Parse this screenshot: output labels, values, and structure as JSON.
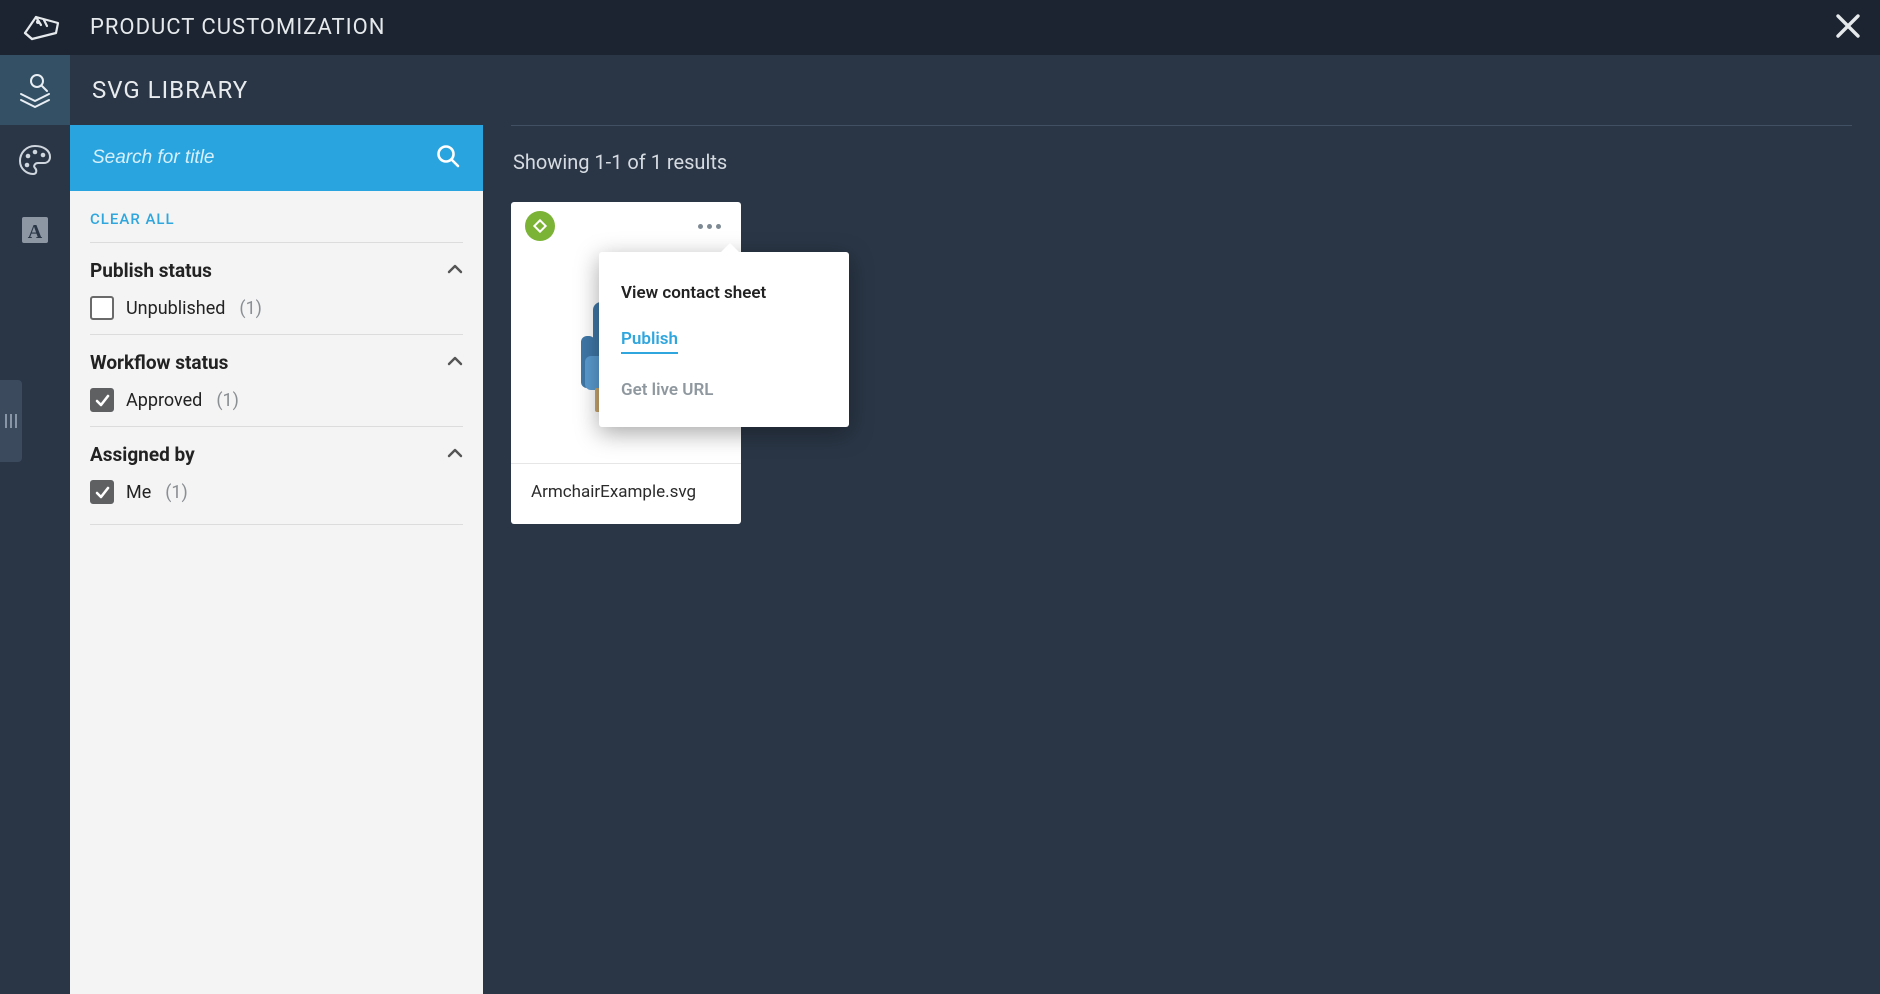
{
  "topbar": {
    "title": "PRODUCT CUSTOMIZATION"
  },
  "library": {
    "title": "SVG LIBRARY"
  },
  "search": {
    "placeholder": "Search for title"
  },
  "filters": {
    "clear_all": "CLEAR ALL",
    "sections": [
      {
        "title": "Publish status",
        "options": [
          {
            "label": "Unpublished",
            "count": "(1)",
            "checked": false
          }
        ]
      },
      {
        "title": "Workflow status",
        "options": [
          {
            "label": "Approved",
            "count": "(1)",
            "checked": true
          }
        ]
      },
      {
        "title": "Assigned by",
        "options": [
          {
            "label": "Me",
            "count": "(1)",
            "checked": true
          }
        ]
      }
    ]
  },
  "results": {
    "summary": "Showing 1-1 of 1 results"
  },
  "card": {
    "filename": "ArmchairExample.svg"
  },
  "popover": {
    "view_contact_sheet": "View contact sheet",
    "publish": "Publish",
    "get_live_url": "Get live URL"
  }
}
